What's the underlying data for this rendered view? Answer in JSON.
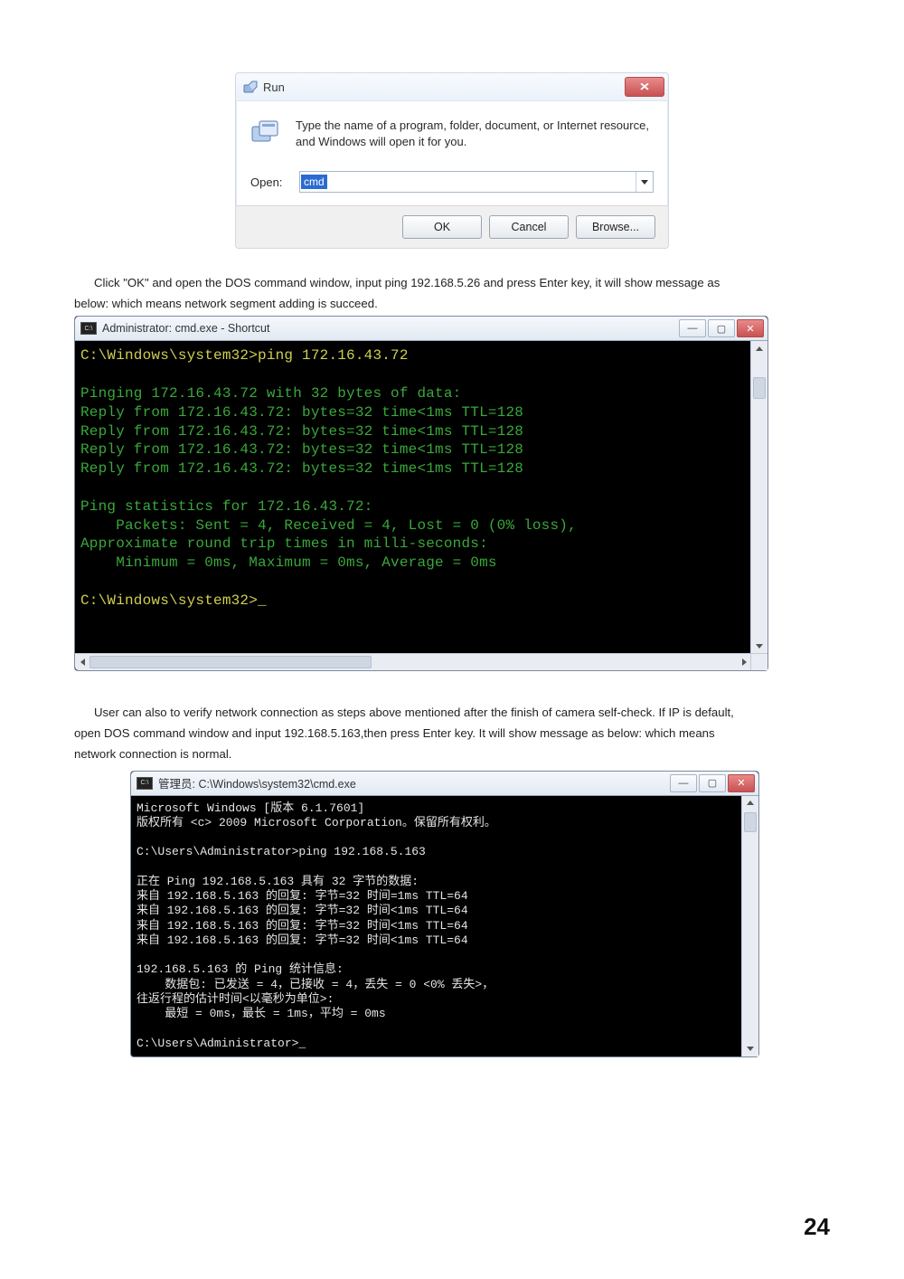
{
  "run_dialog": {
    "title": "Run",
    "description": "Type the name of a program, folder, document, or Internet resource, and Windows will open it for you.",
    "open_label": "Open:",
    "open_value": "cmd",
    "buttons": {
      "ok": "OK",
      "cancel": "Cancel",
      "browse": "Browse..."
    }
  },
  "para1a": "Click \"OK\" and open the DOS command window, input ping 192.168.5.26 and press Enter key, it will show message as",
  "para1b": "below: which means network segment adding is succeed.",
  "cmd1": {
    "title": "Administrator: cmd.exe - Shortcut",
    "prompt1": "C:\\Windows\\system32>",
    "command1": "ping 172.16.43.72",
    "header": "Pinging 172.16.43.72 with 32 bytes of data:",
    "reply": "Reply from 172.16.43.72: bytes=32 time<1ms TTL=128",
    "stats_title": "Ping statistics for 172.16.43.72:",
    "packets": "    Packets: Sent = 4, Received = 4, Lost = 0 (0% loss),",
    "approx": "Approximate round trip times in milli-seconds:",
    "minmax": "    Minimum = 0ms, Maximum = 0ms, Average = 0ms",
    "prompt2": "C:\\Windows\\system32>_"
  },
  "para2a": "User can also to verify network connection as steps above mentioned after the finish of camera self-check. If IP is default,",
  "para2b": "open DOS command window and input 192.168.5.163,then press Enter key. It will show message as below: which means",
  "para2c": "network connection is normal.",
  "cmd2": {
    "title": "管理员: C:\\Windows\\system32\\cmd.exe",
    "l1": "Microsoft Windows [版本 6.1.7601]",
    "l2": "版权所有 <c> 2009 Microsoft Corporation。保留所有权利。",
    "prompt1": "C:\\Users\\Administrator>ping 192.168.5.163",
    "r0": "正在 Ping 192.168.5.163 具有 32 字节的数据:",
    "r1": "来自 192.168.5.163 的回复: 字节=32 时间=1ms TTL=64",
    "r2": "来自 192.168.5.163 的回复: 字节=32 时间<1ms TTL=64",
    "r3": "来自 192.168.5.163 的回复: 字节=32 时间<1ms TTL=64",
    "r4": "来自 192.168.5.163 的回复: 字节=32 时间<1ms TTL=64",
    "s1": "192.168.5.163 的 Ping 统计信息:",
    "s2": "    数据包: 已发送 = 4，已接收 = 4，丢失 = 0 <0% 丢失>，",
    "s3": "往返行程的估计时间<以毫秒为单位>:",
    "s4": "    最短 = 0ms，最长 = 1ms，平均 = 0ms",
    "prompt2": "C:\\Users\\Administrator>_"
  },
  "page_number": "24"
}
